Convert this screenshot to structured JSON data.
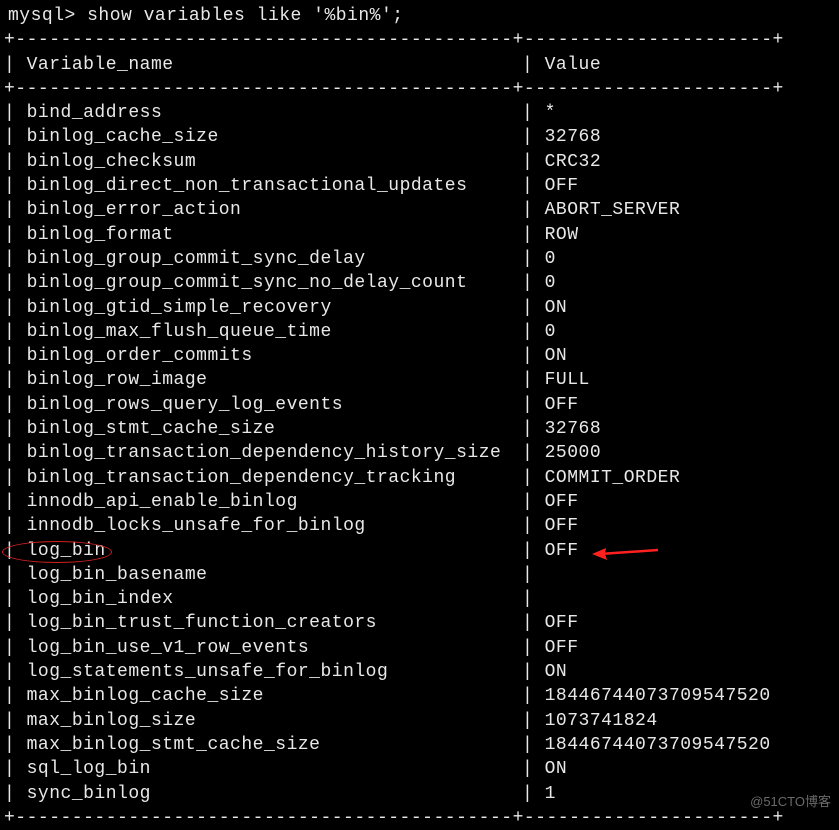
{
  "prompt": "mysql> show variables like '%bin%';",
  "separator_top": "+--------------------------------------------+----------------------+",
  "header": {
    "col1": "Variable_name",
    "col2": "Value"
  },
  "rows": [
    {
      "name": "bind_address",
      "value": "*"
    },
    {
      "name": "binlog_cache_size",
      "value": "32768"
    },
    {
      "name": "binlog_checksum",
      "value": "CRC32"
    },
    {
      "name": "binlog_direct_non_transactional_updates",
      "value": "OFF"
    },
    {
      "name": "binlog_error_action",
      "value": "ABORT_SERVER"
    },
    {
      "name": "binlog_format",
      "value": "ROW"
    },
    {
      "name": "binlog_group_commit_sync_delay",
      "value": "0"
    },
    {
      "name": "binlog_group_commit_sync_no_delay_count",
      "value": "0"
    },
    {
      "name": "binlog_gtid_simple_recovery",
      "value": "ON"
    },
    {
      "name": "binlog_max_flush_queue_time",
      "value": "0"
    },
    {
      "name": "binlog_order_commits",
      "value": "ON"
    },
    {
      "name": "binlog_row_image",
      "value": "FULL"
    },
    {
      "name": "binlog_rows_query_log_events",
      "value": "OFF"
    },
    {
      "name": "binlog_stmt_cache_size",
      "value": "32768"
    },
    {
      "name": "binlog_transaction_dependency_history_size",
      "value": "25000"
    },
    {
      "name": "binlog_transaction_dependency_tracking",
      "value": "COMMIT_ORDER"
    },
    {
      "name": "innodb_api_enable_binlog",
      "value": "OFF"
    },
    {
      "name": "innodb_locks_unsafe_for_binlog",
      "value": "OFF"
    },
    {
      "name": "log_bin",
      "value": "OFF"
    },
    {
      "name": "log_bin_basename",
      "value": ""
    },
    {
      "name": "log_bin_index",
      "value": ""
    },
    {
      "name": "log_bin_trust_function_creators",
      "value": "OFF"
    },
    {
      "name": "log_bin_use_v1_row_events",
      "value": "OFF"
    },
    {
      "name": "log_statements_unsafe_for_binlog",
      "value": "ON"
    },
    {
      "name": "max_binlog_cache_size",
      "value": "18446744073709547520"
    },
    {
      "name": "max_binlog_size",
      "value": "1073741824"
    },
    {
      "name": "max_binlog_stmt_cache_size",
      "value": "18446744073709547520"
    },
    {
      "name": "sql_log_bin",
      "value": "ON"
    },
    {
      "name": "sync_binlog",
      "value": "1"
    }
  ],
  "watermark": "@51CTO博客"
}
